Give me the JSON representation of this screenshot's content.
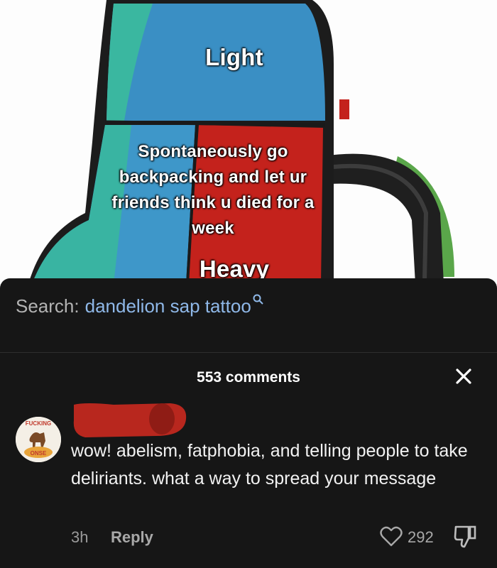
{
  "video": {
    "label_top": "Light",
    "label_middle_lines": [
      "Spontaneously go",
      "backpacking and let ur",
      "friends think u died for a",
      "week"
    ],
    "label_bottom": "Heavy",
    "colors": {
      "blue": "#3a8fc4",
      "teal": "#3ab7a0",
      "red": "#c4221c",
      "dark": "#2a2a2a"
    }
  },
  "search": {
    "prefix": "Search:",
    "query": "dandelion sap tattoo",
    "icon": "search-icon"
  },
  "comments": {
    "count_label": "553 comments",
    "close_icon": "close-icon"
  },
  "comment": {
    "avatar_text_top": "FUCKING",
    "avatar_text_bottom": "ONSE",
    "text": "wow! abelism, fatphobia, and telling people to take deliriants. what a way to spread your message",
    "time": "3h",
    "reply_label": "Reply",
    "like_count": "292",
    "like_icon": "heart-outline-icon",
    "dislike_icon": "thumbs-down-icon",
    "redaction_color": "#b8271e"
  }
}
